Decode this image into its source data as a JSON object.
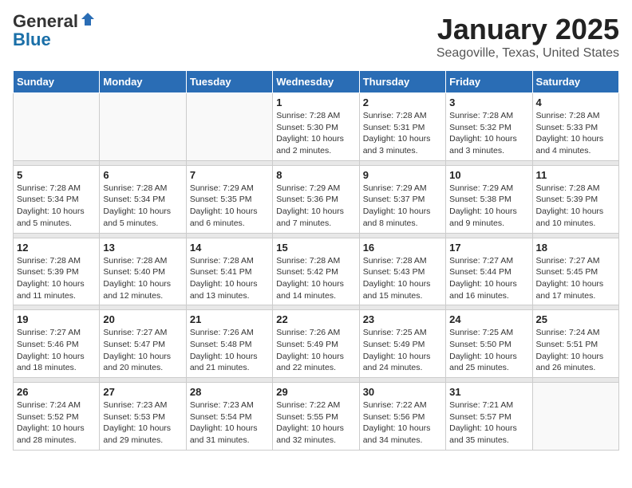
{
  "logo": {
    "general": "General",
    "blue": "Blue"
  },
  "title": "January 2025",
  "subtitle": "Seagoville, Texas, United States",
  "days_of_week": [
    "Sunday",
    "Monday",
    "Tuesday",
    "Wednesday",
    "Thursday",
    "Friday",
    "Saturday"
  ],
  "weeks": [
    [
      {
        "day": "",
        "info": ""
      },
      {
        "day": "",
        "info": ""
      },
      {
        "day": "",
        "info": ""
      },
      {
        "day": "1",
        "info": "Sunrise: 7:28 AM\nSunset: 5:30 PM\nDaylight: 10 hours\nand 2 minutes."
      },
      {
        "day": "2",
        "info": "Sunrise: 7:28 AM\nSunset: 5:31 PM\nDaylight: 10 hours\nand 3 minutes."
      },
      {
        "day": "3",
        "info": "Sunrise: 7:28 AM\nSunset: 5:32 PM\nDaylight: 10 hours\nand 3 minutes."
      },
      {
        "day": "4",
        "info": "Sunrise: 7:28 AM\nSunset: 5:33 PM\nDaylight: 10 hours\nand 4 minutes."
      }
    ],
    [
      {
        "day": "5",
        "info": "Sunrise: 7:28 AM\nSunset: 5:34 PM\nDaylight: 10 hours\nand 5 minutes."
      },
      {
        "day": "6",
        "info": "Sunrise: 7:28 AM\nSunset: 5:34 PM\nDaylight: 10 hours\nand 5 minutes."
      },
      {
        "day": "7",
        "info": "Sunrise: 7:29 AM\nSunset: 5:35 PM\nDaylight: 10 hours\nand 6 minutes."
      },
      {
        "day": "8",
        "info": "Sunrise: 7:29 AM\nSunset: 5:36 PM\nDaylight: 10 hours\nand 7 minutes."
      },
      {
        "day": "9",
        "info": "Sunrise: 7:29 AM\nSunset: 5:37 PM\nDaylight: 10 hours\nand 8 minutes."
      },
      {
        "day": "10",
        "info": "Sunrise: 7:29 AM\nSunset: 5:38 PM\nDaylight: 10 hours\nand 9 minutes."
      },
      {
        "day": "11",
        "info": "Sunrise: 7:28 AM\nSunset: 5:39 PM\nDaylight: 10 hours\nand 10 minutes."
      }
    ],
    [
      {
        "day": "12",
        "info": "Sunrise: 7:28 AM\nSunset: 5:39 PM\nDaylight: 10 hours\nand 11 minutes."
      },
      {
        "day": "13",
        "info": "Sunrise: 7:28 AM\nSunset: 5:40 PM\nDaylight: 10 hours\nand 12 minutes."
      },
      {
        "day": "14",
        "info": "Sunrise: 7:28 AM\nSunset: 5:41 PM\nDaylight: 10 hours\nand 13 minutes."
      },
      {
        "day": "15",
        "info": "Sunrise: 7:28 AM\nSunset: 5:42 PM\nDaylight: 10 hours\nand 14 minutes."
      },
      {
        "day": "16",
        "info": "Sunrise: 7:28 AM\nSunset: 5:43 PM\nDaylight: 10 hours\nand 15 minutes."
      },
      {
        "day": "17",
        "info": "Sunrise: 7:27 AM\nSunset: 5:44 PM\nDaylight: 10 hours\nand 16 minutes."
      },
      {
        "day": "18",
        "info": "Sunrise: 7:27 AM\nSunset: 5:45 PM\nDaylight: 10 hours\nand 17 minutes."
      }
    ],
    [
      {
        "day": "19",
        "info": "Sunrise: 7:27 AM\nSunset: 5:46 PM\nDaylight: 10 hours\nand 18 minutes."
      },
      {
        "day": "20",
        "info": "Sunrise: 7:27 AM\nSunset: 5:47 PM\nDaylight: 10 hours\nand 20 minutes."
      },
      {
        "day": "21",
        "info": "Sunrise: 7:26 AM\nSunset: 5:48 PM\nDaylight: 10 hours\nand 21 minutes."
      },
      {
        "day": "22",
        "info": "Sunrise: 7:26 AM\nSunset: 5:49 PM\nDaylight: 10 hours\nand 22 minutes."
      },
      {
        "day": "23",
        "info": "Sunrise: 7:25 AM\nSunset: 5:49 PM\nDaylight: 10 hours\nand 24 minutes."
      },
      {
        "day": "24",
        "info": "Sunrise: 7:25 AM\nSunset: 5:50 PM\nDaylight: 10 hours\nand 25 minutes."
      },
      {
        "day": "25",
        "info": "Sunrise: 7:24 AM\nSunset: 5:51 PM\nDaylight: 10 hours\nand 26 minutes."
      }
    ],
    [
      {
        "day": "26",
        "info": "Sunrise: 7:24 AM\nSunset: 5:52 PM\nDaylight: 10 hours\nand 28 minutes."
      },
      {
        "day": "27",
        "info": "Sunrise: 7:23 AM\nSunset: 5:53 PM\nDaylight: 10 hours\nand 29 minutes."
      },
      {
        "day": "28",
        "info": "Sunrise: 7:23 AM\nSunset: 5:54 PM\nDaylight: 10 hours\nand 31 minutes."
      },
      {
        "day": "29",
        "info": "Sunrise: 7:22 AM\nSunset: 5:55 PM\nDaylight: 10 hours\nand 32 minutes."
      },
      {
        "day": "30",
        "info": "Sunrise: 7:22 AM\nSunset: 5:56 PM\nDaylight: 10 hours\nand 34 minutes."
      },
      {
        "day": "31",
        "info": "Sunrise: 7:21 AM\nSunset: 5:57 PM\nDaylight: 10 hours\nand 35 minutes."
      },
      {
        "day": "",
        "info": ""
      }
    ]
  ]
}
